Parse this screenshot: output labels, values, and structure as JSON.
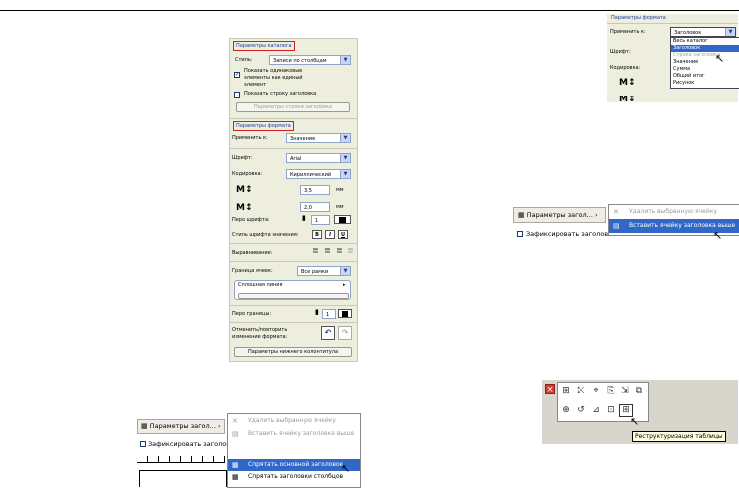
{
  "panel_main": {
    "catalog_section": "Параметры каталога",
    "style_label": "Стиль:",
    "style_value": "Записи по столбцам",
    "show_same_check": "✓",
    "show_same_label_1": "Показать одинаковые",
    "show_same_label_2": "элементы как единый",
    "show_same_label_3": "элемент",
    "show_header_row_label": "Показать строку заголовка",
    "header_row_params_button": "Параметры строки заголовка",
    "format_section": "Параметры формата",
    "apply_to_label": "Применить к:",
    "apply_to_value": "Значение",
    "font_label": "Шрифт:",
    "font_value": "Arial",
    "encoding_label": "Кодировка:",
    "encoding_value": "Кириллический",
    "size_value_1": "3,5",
    "size_unit_1": "мм",
    "size_value_2": "2,0",
    "size_unit_2": "мм",
    "font_pen_label": "Перо шрифта:",
    "font_pen_value": "1",
    "value_style_label": "Стиль шрифта значения:",
    "bold_label": "B",
    "italic_label": "I",
    "underline_label": "U",
    "align_label": "Выравнивание:",
    "cell_border_label": "Граница ячеек:",
    "cell_border_value": "Все рамки",
    "line_type_value": "Сплошная линия",
    "border_pen_label": "Перо границы:",
    "border_pen_value": "1",
    "undo_label_1": "Отменить/повторить",
    "undo_label_2": "изменение формата:",
    "footer_params_button": "Параметры нижнего колонтитула"
  },
  "dropdown_panel": {
    "section": "Параметры формата",
    "apply_to_label": "Применить к:",
    "apply_to_value": "Заголовок",
    "font_label": "Шрифт:",
    "encoding_label": "Кодировка:",
    "options": [
      "Весь каталог",
      "Заголовок",
      "Строка заголовка",
      "Значение",
      "Сумма",
      "Общий итог",
      "Рисунок"
    ],
    "selected_index": 1
  },
  "context_right": {
    "button_label": "Параметры загол...",
    "fix_header_label": "Зафиксировать заголов",
    "items": [
      "Удалить выбранную ячейку",
      "Вставить ячейку заголовка выше"
    ]
  },
  "context_bottom": {
    "button_label": "Параметры загол...",
    "fix_header_label": "Зафиксировать заголов",
    "items": [
      "Удалить выбранную ячейку",
      "Вставить ячейку заголовка выше",
      "Спрятать основной заголовок",
      "Спрятать заголовки столбцов"
    ]
  },
  "toolbar": {
    "close_label": "×",
    "tooltip": "Реструктуризация таблицы"
  }
}
